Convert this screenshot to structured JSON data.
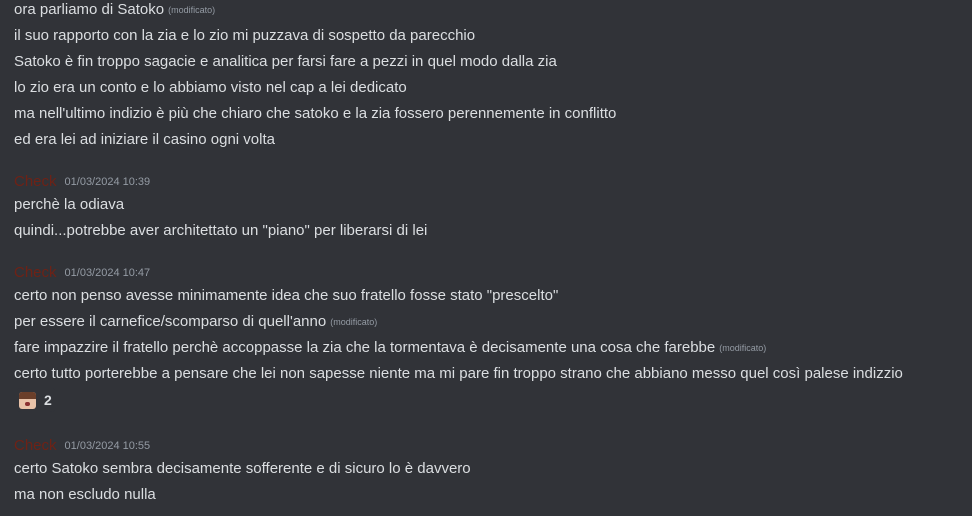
{
  "colors": {
    "background": "#313338",
    "text": "#dbdee1",
    "muted": "#949ba4",
    "username": "#6e2216"
  },
  "messages": {
    "top": {
      "lines": [
        {
          "text": "ora parliamo di Satoko",
          "edited": "(modificato)"
        },
        {
          "text": "il suo rapporto con la zia e lo zio mi puzzava di sospetto da parecchio"
        },
        {
          "text": "Satoko è fin troppo sagacie e analitica per farsi fare a pezzi in quel modo dalla zia"
        },
        {
          "text": "lo zio era un conto e lo abbiamo visto nel cap a lei dedicato"
        },
        {
          "text": "ma nell'ultimo indizio è più che chiaro che satoko e la zia fossero perennemente in conflitto"
        },
        {
          "text": "ed era lei ad iniziare il casino ogni volta"
        }
      ]
    },
    "group1": {
      "author": "Check",
      "timestamp": "01/03/2024 10:39",
      "lines": [
        {
          "text": "perchè la odiava"
        },
        {
          "text": "quindi...potrebbe aver architettato un \"piano\" per liberarsi di lei"
        }
      ]
    },
    "group2": {
      "author": "Check",
      "timestamp": "01/03/2024 10:47",
      "lines": [
        {
          "text": "certo non penso avesse minimamente idea che suo fratello fosse stato \"prescelto\""
        },
        {
          "text": "per essere il carnefice/scomparso di quell'anno",
          "edited": "(modificato)"
        },
        {
          "text": "fare impazzire il fratello perchè accoppasse la zia che la tormentava è decisamente una cosa che farebbe",
          "edited": "(modificato)"
        },
        {
          "text": "certo tutto porterebbe a pensare che lei non sapesse niente ma mi pare fin troppo strano che abbiano messo quel così palese indizzio"
        }
      ],
      "reaction": {
        "icon": "girl-face-emoji-icon",
        "count": "2"
      }
    },
    "group3": {
      "author": "Check",
      "timestamp": "01/03/2024 10:55",
      "lines": [
        {
          "text": "certo Satoko sembra decisamente sofferente e di sicuro lo è davvero"
        },
        {
          "text": "ma non escludo nulla"
        }
      ]
    }
  }
}
